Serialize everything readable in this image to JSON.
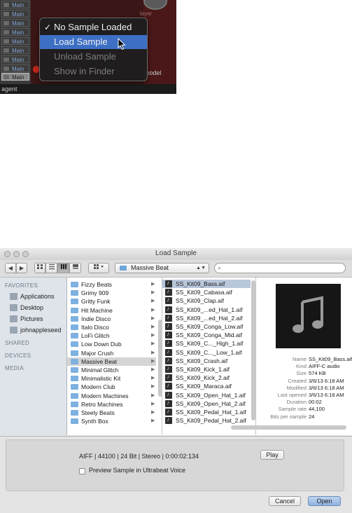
{
  "synth": {
    "row_buttons": [
      "Main",
      "Main",
      "Main",
      "Main",
      "Main",
      "Main",
      "Main",
      "Main",
      "Main"
    ],
    "active_button": "Main",
    "layer_label": "layer",
    "model_label": "model",
    "agent_label": "agent",
    "menu": {
      "items": [
        {
          "label": "No Sample Loaded",
          "checked": true,
          "state": "normal"
        },
        {
          "label": "Load Sample",
          "checked": false,
          "state": "highlighted"
        },
        {
          "label": "Unload Sample",
          "checked": false,
          "state": "disabled"
        },
        {
          "label": "Show in Finder",
          "checked": false,
          "state": "disabled"
        }
      ],
      "check_glyph": "✓"
    }
  },
  "dialog": {
    "title": "Load Sample",
    "toolbar": {
      "back_icon": "◀",
      "forward_icon": "▶",
      "view_icons": [
        "icon-view",
        "list-view",
        "column-view",
        "coverflow-view"
      ],
      "action_icon": "gear-icon",
      "path_popup": "Massive Beat",
      "search_placeholder": ""
    },
    "sidebar": {
      "favorites_head": "FAVORITES",
      "favorites": [
        "Applications",
        "Desktop",
        "Pictures",
        "johnappleseed"
      ],
      "shared_head": "SHARED",
      "devices_head": "DEVICES",
      "media_head": "MEDIA"
    },
    "folders": [
      "Fizzy Beats",
      "Grimy 909",
      "Gritty Funk",
      "Hit Machine",
      "Indie Disco",
      "Italo Disco",
      "LoFi Glitch",
      "Low Down Dub",
      "Major Crush",
      "Massive Beat",
      "Minimal Glitch",
      "Minimalistic Kit",
      "Modern Club",
      "Modern Machines",
      "Retro Machines",
      "Steely Beats",
      "Synth Box"
    ],
    "selected_folder": "Massive Beat",
    "files": [
      "SS_Kit09_Bass.aif",
      "SS_Kit09_Cabasa.aif",
      "SS_Kit09_Clap.aif",
      "SS_Kit09_...ed_Hat_1.aif",
      "SS_Kit09_...ed_Hat_2.aif",
      "SS_Kit09_Conga_Low.aif",
      "SS_Kit09_Conga_Mid.aif",
      "SS_Kit09_C..._High_1.aif",
      "SS_Kit09_C..._Low_1.aif",
      "SS_Kit09_Crash.aif",
      "SS_Kit09_Kick_1.aif",
      "SS_Kit09_Kick_2.aif",
      "SS_Kit09_Maraca.aif",
      "SS_Kit09_Open_Hat_1.aif",
      "SS_Kit09_Open_Hat_2.aif",
      "SS_Kit09_Pedal_Hat_1.aif",
      "SS_Kit09_Pedal_Hat_2.aif"
    ],
    "selected_file": "SS_Kit09_Bass.aif",
    "preview": {
      "rows": [
        {
          "k": "Name",
          "v": "SS_Kit09_Bass.aif"
        },
        {
          "k": "Kind",
          "v": "AIFF-C audio"
        },
        {
          "k": "Size",
          "v": "574 KB"
        },
        {
          "k": "Created",
          "v": "3/6/13 6:18 AM"
        },
        {
          "k": "Modified",
          "v": "3/6/13 6:18 AM"
        },
        {
          "k": "Last opened",
          "v": "3/6/13 6:18 AM"
        },
        {
          "k": "Duration",
          "v": "00:02"
        },
        {
          "k": "Sample rate",
          "v": "44,100"
        },
        {
          "k": "Bits per sample",
          "v": "24"
        }
      ]
    },
    "info_line": "AIFF  |  44100  |  24 Bit  |  Stereo  |  0:00:02:134",
    "play_label": "Play",
    "preview_checkbox_label": "Preview Sample in Ultrabeat Voice",
    "cancel_label": "Cancel",
    "open_label": "Open"
  }
}
